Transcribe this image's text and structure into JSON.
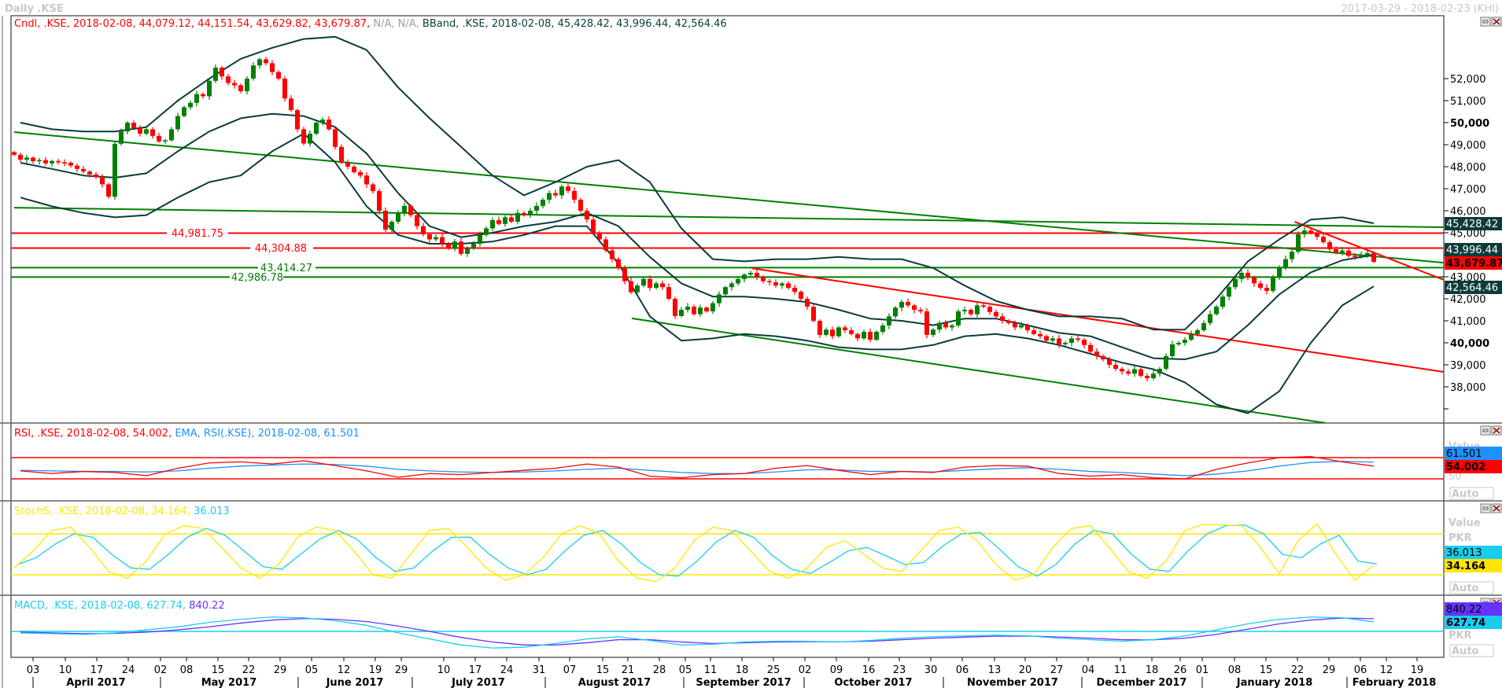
{
  "header": {
    "title": "Daily .KSE",
    "range": "2017-03-29 - 2018-02-23 (KHI)"
  },
  "colors": {
    "up": "#008000",
    "down": "#ff0000",
    "bband": "#0a3c3c",
    "rsi": "#ff0000",
    "rsi_ema": "#1e90ff",
    "stoch_k": "#ffe600",
    "stoch_d": "#19cdf0",
    "macd": "#19cdf0",
    "macd_signal": "#6633ff",
    "trend_green": "#008000",
    "trend_red": "#ff0000"
  },
  "price_pane": {
    "legend": {
      "cndl": "Cndl, .KSE, 2018-02-08, 44,079.12, 44,151.54, 43,629.82, 43,679.87,",
      "na": " N/A, N/A, ",
      "bband": "BBand, .KSE, 2018-02-08, 45,428.42, 43,996.44, 42,564.46"
    },
    "axis_labels": [
      "52,000",
      "51,000",
      "50,000",
      "49,000",
      "48,000",
      "47,000",
      "46,000",
      "45,000",
      "43,000",
      "42,000",
      "41,000",
      "40,000",
      "39,000",
      "38,000"
    ],
    "axis_values": [
      52000,
      51000,
      50000,
      49000,
      48000,
      47000,
      46000,
      45000,
      43000,
      42000,
      41000,
      40000,
      39000,
      38000,
      37000,
      44000
    ],
    "value_labels": {
      "bb_upper": "45,428.42",
      "bb_middle": "43,996.44",
      "last": "43,679.87",
      "bb_lower": "42,564.46"
    },
    "level_labels": {
      "r1": "44,981.75",
      "r2": "44,304.88",
      "g1": "43,414.27",
      "g2": "42,986.78"
    }
  },
  "rsi_pane": {
    "legend_rsi": "RSI, .KSE, 2018-02-08, 54.002, ",
    "legend_ema": "EMA, RSI(.KSE), 2018-02-08, 61.501",
    "value_caption": "Value",
    "ema_value": "61.501",
    "rsi_value": "54.002",
    "scale_label": "50",
    "auto": "Auto"
  },
  "stoch_pane": {
    "legend_k": "StochS, .KSE, 2018-02-08, 34.164, ",
    "legend_d": "36.013",
    "value_caption": "Value",
    "unit": "PKR",
    "d_value": "36.013",
    "k_value": "34.164",
    "auto": "Auto"
  },
  "macd_pane": {
    "legend_macd": "MACD, .KSE, 2018-02-08, 627.74, ",
    "legend_signal": "840.22",
    "signal_value": "840.22",
    "macd_value": "627.74",
    "unit": "PKR",
    "auto": "Auto"
  },
  "time_axis": {
    "days": [
      "03",
      "10",
      "17",
      "24",
      "02",
      "08",
      "15",
      "22",
      "29",
      "05",
      "12",
      "19",
      "29",
      "10",
      "17",
      "24",
      "31",
      "07",
      "15",
      "21",
      "28",
      "05",
      "11",
      "18",
      "25",
      "02",
      "09",
      "16",
      "23",
      "30",
      "06",
      "13",
      "20",
      "27",
      "04",
      "11",
      "18",
      "26",
      "01",
      "08",
      "15",
      "22",
      "29",
      "06",
      "12",
      "19"
    ],
    "months": [
      "April 2017",
      "May 2017",
      "June 2017",
      "July 2017",
      "August 2017",
      "September 2017",
      "October 2017",
      "November 2017",
      "December 2017",
      "January 2018",
      "February 2018"
    ]
  },
  "chart_data": [
    {
      "type": "candlestick",
      "title": "Cndl, .KSE",
      "start_date": "2017-03-29",
      "last_bar": {
        "date": "2018-02-08",
        "open": 44079.12,
        "high": 44151.54,
        "low": 43629.82,
        "close": 43679.87
      },
      "ylim": [
        36500,
        53500
      ],
      "closes": [
        48540,
        48320,
        48410,
        48250,
        48300,
        48150,
        48260,
        48200,
        48180,
        48050,
        47900,
        47780,
        47650,
        47530,
        47200,
        46640,
        49040,
        49600,
        50000,
        49750,
        49500,
        49700,
        49400,
        49150,
        49200,
        49700,
        50300,
        50700,
        50900,
        51300,
        51200,
        51900,
        52500,
        52100,
        51800,
        51700,
        51430,
        52000,
        52600,
        52880,
        52700,
        52300,
        52000,
        51100,
        50570,
        49700,
        49050,
        49500,
        50000,
        50140,
        49700,
        48900,
        48180,
        48000,
        47750,
        47600,
        47200,
        46890,
        46000,
        45140,
        45500,
        45900,
        46220,
        45800,
        45300,
        44930,
        44700,
        44800,
        44500,
        44300,
        44600,
        44040,
        44300,
        44500,
        44900,
        45200,
        45570,
        45400,
        45700,
        45500,
        45900,
        45790,
        46000,
        46220,
        46500,
        46800,
        46700,
        47100,
        46900,
        46500,
        46000,
        45600,
        45000,
        44700,
        44200,
        43800,
        43390,
        42800,
        42300,
        42600,
        42900,
        42500,
        42700,
        42530,
        42000,
        41220,
        41500,
        41640,
        41300,
        41600,
        41430,
        41800,
        42200,
        42530,
        42700,
        42900,
        43100,
        43180,
        43000,
        42800,
        42750,
        42600,
        42700,
        42500,
        42320,
        42000,
        41640,
        41000,
        40360,
        40600,
        40300,
        40700,
        40570,
        40400,
        40200,
        40500,
        40140,
        40500,
        40790,
        41200,
        41600,
        41860,
        41700,
        41500,
        41430,
        40360,
        40600,
        40900,
        40700,
        40790,
        41430,
        41500,
        41300,
        41700,
        41640,
        41400,
        41200,
        41000,
        40900,
        40700,
        40800,
        40570,
        40400,
        40300,
        40100,
        40200,
        39930,
        40000,
        40200,
        40140,
        39900,
        39600,
        39400,
        39250,
        39000,
        38820,
        38700,
        38600,
        38800,
        38500,
        38390,
        38600,
        38820,
        39400,
        39930,
        40000,
        40140,
        40400,
        40570,
        40900,
        41300,
        41640,
        42100,
        42530,
        42900,
        43180,
        42960,
        42700,
        42500,
        42360,
        43000,
        43400,
        43800,
        44140,
        44930,
        45100,
        45000,
        44820,
        44570,
        44250,
        44100,
        44190,
        43950,
        43900,
        43980,
        44079.12,
        43679.87
      ],
      "bbands": {
        "upper": [
          50000,
          49700,
          49600,
          49600,
          49800,
          51000,
          52000,
          52900,
          53400,
          53800,
          53900,
          53300,
          51600,
          50200,
          48900,
          47600,
          46700,
          47300,
          48000,
          48300,
          47300,
          45200,
          43800,
          43700,
          43800,
          43800,
          43900,
          43800,
          43800,
          43400,
          42600,
          41900,
          41500,
          41200,
          41200,
          41100,
          40600,
          40600,
          42000,
          43700,
          44700,
          45600,
          45700,
          45428.42
        ],
        "middle": [
          48180,
          47900,
          47600,
          47500,
          47700,
          48700,
          49600,
          50200,
          50400,
          50300,
          49800,
          48600,
          46800,
          45300,
          44800,
          45000,
          45300,
          45500,
          45900,
          45300,
          43900,
          42700,
          42100,
          42100,
          42000,
          41850,
          41500,
          41100,
          41000,
          40800,
          41100,
          41100,
          40800,
          40450,
          40300,
          39800,
          39300,
          39250,
          39600,
          40800,
          42200,
          43200,
          43750,
          43996.44
        ],
        "lower": [
          46600,
          46200,
          45900,
          45700,
          45800,
          46600,
          47300,
          47600,
          48700,
          49500,
          48200,
          46200,
          44900,
          44500,
          44500,
          44600,
          44900,
          45300,
          45300,
          43600,
          41200,
          40100,
          40200,
          40400,
          40300,
          40100,
          39800,
          39700,
          39700,
          39900,
          40300,
          40400,
          40200,
          39900,
          39500,
          39100,
          38800,
          38200,
          37200,
          36800,
          37800,
          40000,
          41700,
          42564.46
        ]
      },
      "horizontal_levels": [
        {
          "value": 44981.75,
          "color": "red"
        },
        {
          "value": 44304.88,
          "color": "red"
        },
        {
          "value": 43414.27,
          "color": "green"
        },
        {
          "value": 42986.78,
          "color": "green"
        }
      ],
      "trendlines": [
        {
          "color": "green",
          "from": [
            "2017-03-29",
            49570
          ],
          "to": [
            "2018-02-23",
            43640
          ]
        },
        {
          "color": "green",
          "from": [
            "2017-03-29",
            46140
          ],
          "to": [
            "2018-02-23",
            45250
          ]
        },
        {
          "color": "green",
          "from": [
            "2017-08-22",
            41110
          ],
          "to": [
            "2018-01-29",
            36360
          ]
        },
        {
          "color": "red",
          "from": [
            "2017-09-20",
            43390
          ],
          "to": [
            "2018-02-23",
            38680
          ]
        },
        {
          "color": "red",
          "from": [
            "2018-01-22",
            45500
          ],
          "to": [
            "2018-02-23",
            42860
          ]
        }
      ]
    },
    {
      "type": "line",
      "title": "RSI, .KSE",
      "levels": [
        70,
        30
      ],
      "series": [
        {
          "name": "RSI",
          "values": [
            45,
            40,
            44,
            42,
            36,
            50,
            60,
            62,
            58,
            64,
            55,
            45,
            33,
            40,
            38,
            42,
            46,
            50,
            58,
            52,
            35,
            32,
            38,
            40,
            50,
            55,
            46,
            38,
            44,
            42,
            52,
            55,
            54,
            40,
            35,
            38,
            32,
            30,
            48,
            60,
            70,
            72,
            62,
            54.002
          ]
        },
        {
          "name": "EMA",
          "values": [
            46,
            45,
            44,
            44,
            43,
            45,
            50,
            54,
            56,
            58,
            57,
            54,
            48,
            45,
            43,
            42,
            43,
            45,
            48,
            50,
            46,
            42,
            40,
            40,
            43,
            47,
            47,
            44,
            44,
            43,
            46,
            49,
            51,
            48,
            44,
            42,
            39,
            36,
            39,
            45,
            54,
            61,
            63,
            61.501
          ]
        }
      ]
    },
    {
      "type": "line",
      "title": "StochS, .KSE",
      "levels": [
        80,
        20
      ],
      "series": [
        {
          "name": "%K",
          "values": [
            30,
            55,
            85,
            90,
            60,
            25,
            15,
            40,
            80,
            92,
            88,
            60,
            30,
            15,
            35,
            75,
            90,
            85,
            55,
            20,
            15,
            50,
            85,
            88,
            60,
            30,
            12,
            20,
            45,
            80,
            92,
            80,
            40,
            15,
            10,
            30,
            70,
            90,
            85,
            55,
            25,
            15,
            30,
            60,
            70,
            50,
            30,
            25,
            55,
            85,
            90,
            70,
            35,
            12,
            20,
            60,
            88,
            92,
            60,
            25,
            15,
            40,
            85,
            94,
            93,
            92,
            60,
            22,
            70,
            95,
            50,
            12,
            34.164
          ]
        },
        {
          "name": "%D",
          "values": [
            35,
            45,
            65,
            80,
            75,
            50,
            30,
            28,
            50,
            75,
            88,
            78,
            55,
            32,
            28,
            50,
            72,
            85,
            72,
            45,
            25,
            30,
            55,
            75,
            75,
            50,
            30,
            20,
            28,
            55,
            78,
            85,
            65,
            38,
            20,
            18,
            40,
            68,
            85,
            75,
            48,
            28,
            22,
            38,
            55,
            60,
            48,
            35,
            38,
            62,
            80,
            82,
            58,
            32,
            18,
            35,
            65,
            85,
            80,
            50,
            28,
            25,
            55,
            80,
            92,
            93,
            80,
            50,
            45,
            65,
            78,
            40,
            36.013
          ]
        }
      ]
    },
    {
      "type": "line",
      "title": "MACD, .KSE",
      "levels": [
        0
      ],
      "series": [
        {
          "name": "MACD",
          "values": [
            -100,
            -150,
            -200,
            -100,
            100,
            300,
            600,
            800,
            950,
            900,
            700,
            400,
            -100,
            -500,
            -900,
            -1100,
            -1050,
            -800,
            -500,
            -350,
            -600,
            -900,
            -850,
            -700,
            -650,
            -650,
            -700,
            -600,
            -450,
            -350,
            -300,
            -250,
            -300,
            -450,
            -550,
            -650,
            -550,
            -300,
            100,
            500,
            800,
            950,
            900,
            627.74
          ]
        },
        {
          "name": "Signal",
          "values": [
            -50,
            -100,
            -150,
            -130,
            -50,
            100,
            300,
            550,
            750,
            850,
            800,
            650,
            350,
            0,
            -400,
            -700,
            -900,
            -900,
            -750,
            -550,
            -550,
            -700,
            -800,
            -750,
            -700,
            -680,
            -690,
            -650,
            -550,
            -450,
            -380,
            -320,
            -310,
            -370,
            -450,
            -550,
            -560,
            -450,
            -200,
            150,
            500,
            750,
            880,
            840.22
          ]
        }
      ]
    }
  ]
}
